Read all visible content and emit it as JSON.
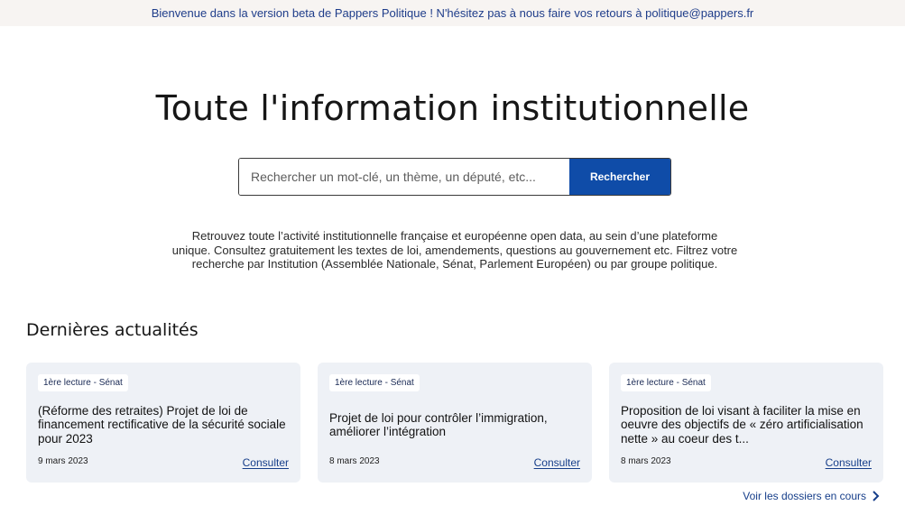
{
  "banner": {
    "text": "Bienvenue dans la version beta de Pappers Politique ! N'hésitez pas à nous faire vos retours à politique@pappers.fr"
  },
  "hero": {
    "title": "Toute l'information institutionnelle"
  },
  "search": {
    "placeholder": "Rechercher un mot-clé, un thème, un député, etc...",
    "value": "",
    "button_label": "Rechercher"
  },
  "intro": {
    "text": "Retrouvez toute l’activité institutionnelle française et européenne open data, au sein d’une plateforme unique. Consultez gratuitement les textes de loi, amendements, questions au gouvernement etc. Filtrez votre recherche par Institution (Assemblée Nationale, Sénat, Parlement Européen) ou par groupe politique."
  },
  "news": {
    "title": "Dernières actualités",
    "cards": [
      {
        "badge": "1ère lecture - Sénat",
        "title": "(Réforme des retraites) Projet de loi de financement rectificative de la sécurité sociale pour 2023",
        "date": "9 mars 2023",
        "link": "Consulter"
      },
      {
        "badge": "1ère lecture - Sénat",
        "title": "Projet de loi pour contrôler l’immigration, améliorer l’intégration",
        "date": "8 mars 2023",
        "link": "Consulter"
      },
      {
        "badge": "1ère lecture - Sénat",
        "title": "Proposition de loi visant à faciliter la mise en oeuvre des objectifs de « zéro artificialisation nette » au coeur des t...",
        "date": "8 mars 2023",
        "link": "Consulter"
      }
    ],
    "more_link": "Voir les dossiers en cours"
  },
  "colors": {
    "accent": "#0f4ca8",
    "link": "#163e8a",
    "banner_bg": "#f7f4f2",
    "card_bg": "#eef1f6"
  },
  "icons": {
    "more_link_icon": "chevron-right-icon"
  }
}
